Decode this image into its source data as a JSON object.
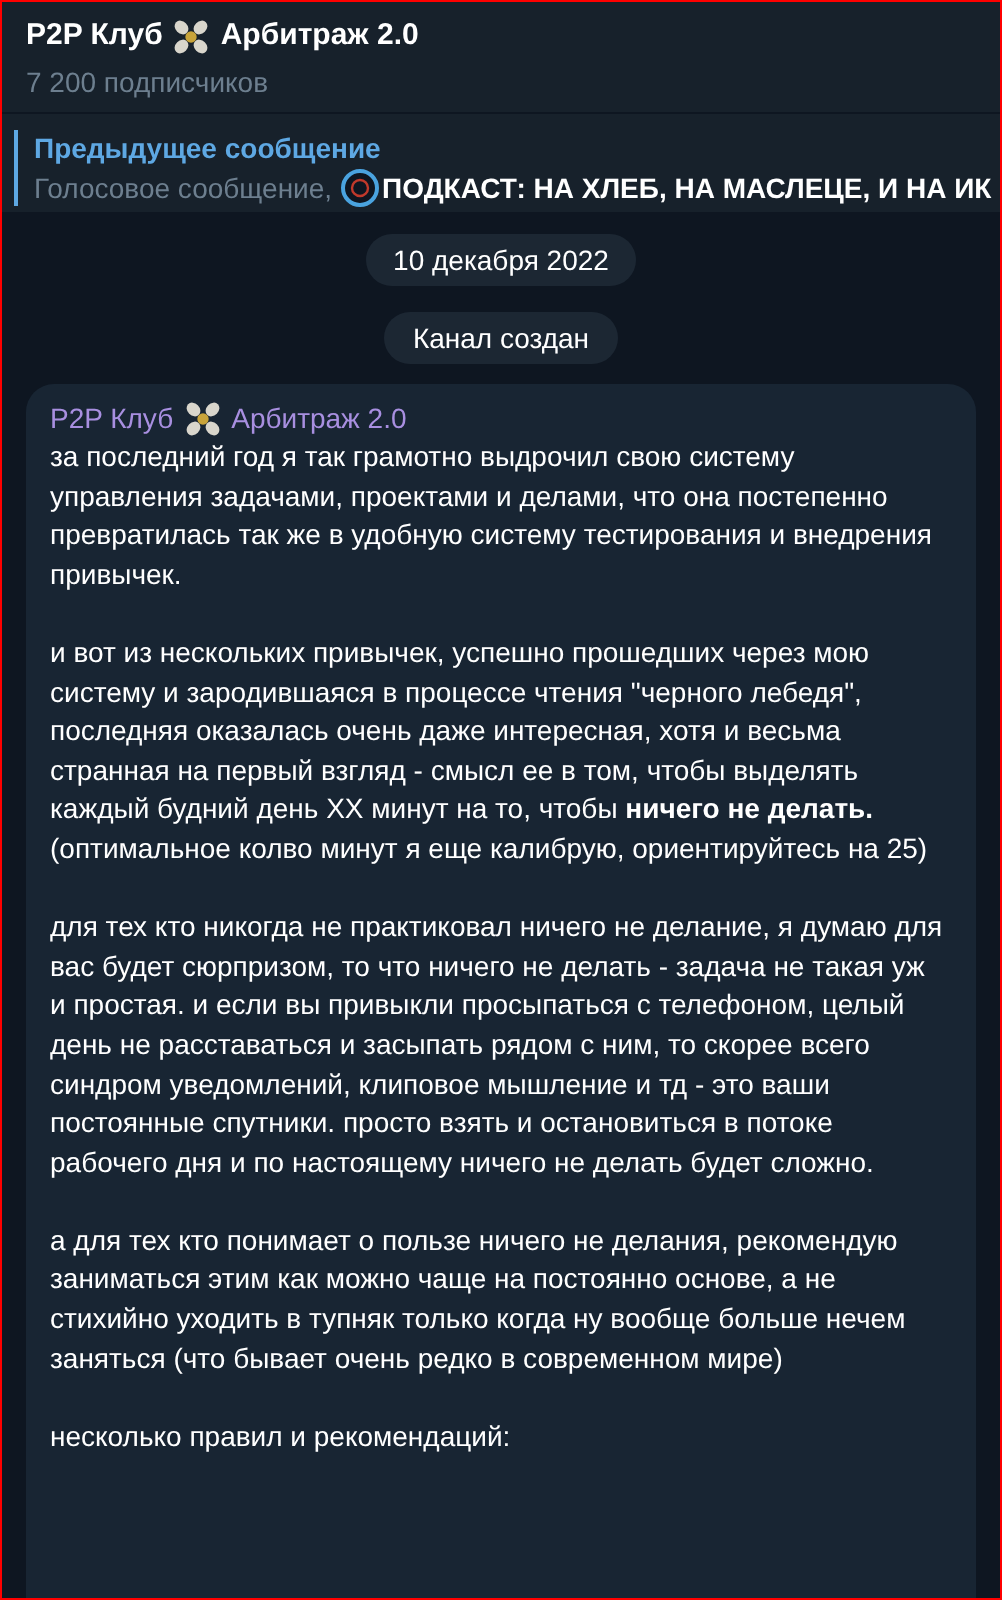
{
  "header": {
    "title_before": "P2P Клуб",
    "title_after": "Арбитраж 2.0",
    "subtitle": "7 200 подписчиков"
  },
  "reply": {
    "label": "Предыдущее сообщение",
    "prefix": "Голосовое сообщение,",
    "text": "ПОДКАСТ: НА ХЛЕБ, НА МАСЛЕЦЕ, И НА ИК"
  },
  "service": [
    "10 декабря 2022",
    "Канал создан"
  ],
  "message": {
    "author_before": "P2P Клуб",
    "author_after": "Арбитраж 2.0",
    "paragraphs": [
      "за последний год я так грамотно выдрочил свою систему управления задачами, проектами и делами, что она постепенно превратилась так же в удобную систему тестирования и внедрения привычек.",
      "и вот из нескольких привычек, успешно прошедших через мою систему и зародившаяся в процессе чтения \"черного лебедя\", последняя оказалась очень даже интересная, хотя и весьма странная на первый взгляд - смысл ее в том, чтобы выделять каждый будний день ХХ минут на то, чтобы **ничего не делать.** (оптимальное колво минут я еще калибрую, ориентируйтесь на 25)",
      "для тех кто никогда не практиковал ничего не делание, я думаю для вас будет сюрпризом, то что ничего не делать - задача не такая уж и простая. и если вы привыкли просыпаться с телефоном, целый день не расставаться и засыпать рядом с ним, то скорее всего синдром уведомлений, клиповое мышление и тд - это ваши постоянные спутники. просто взять и остановиться в потоке рабочего дня и по настоящему ничего не делать будет сложно.",
      "а для тех кто понимает о пользе ничего не делания, рекомендую заниматься этим как можно чаще на постоянно основе, а не стихийно уходить в тупняк только когда ну вообще больше нечем заняться (что бывает очень редко в современном мире)",
      "несколько правил и рекомендаций:"
    ]
  }
}
